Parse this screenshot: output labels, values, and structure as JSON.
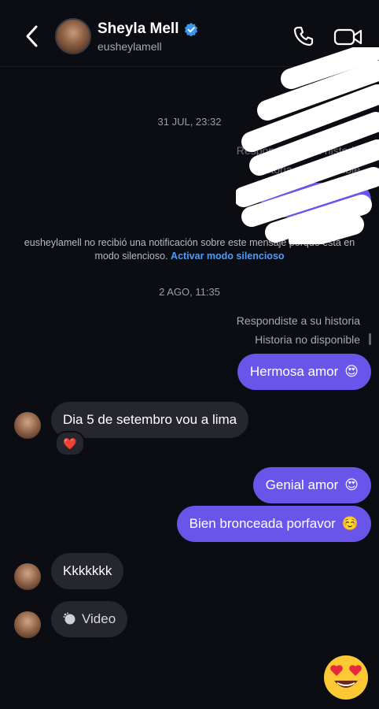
{
  "header": {
    "contact_name": "Sheyla Mell",
    "username": "eusheylamell"
  },
  "thread": {
    "timestamp_1": "31 JUL, 23:32",
    "faded_reply_note": "Respondiste a su historia",
    "faded_story_note": "Historia no disponible",
    "silent_notice_text": "eusheylamell no recibió una notificación sobre este mensaje porque está en modo silencioso.",
    "silent_notice_link": "Activar modo silencioso",
    "timestamp_2": "2 AGO, 11:35",
    "reply_note": "Respondiste a su historia",
    "story_note": "Historia no disponible",
    "messages": [
      {
        "text": "Hermosa amor",
        "emoji": "😍"
      },
      {
        "text": "Dia 5 de setembro vou a lima"
      },
      {
        "text": "Genial amor",
        "emoji": "😍"
      },
      {
        "text": "Bien bronceada porfavor",
        "emoji": "☺️"
      },
      {
        "text": "Kkkkkkk"
      },
      {
        "text": "Video"
      }
    ],
    "reaction": "❤️"
  },
  "colors": {
    "background": "#0c0d12",
    "outgoing_bubble": "#6a55ea",
    "incoming_bubble": "#25262e",
    "link": "#4f9cf5",
    "verified_badge": "#3897f0"
  },
  "icons": [
    "back-chevron-icon",
    "verified-badge-icon",
    "phone-icon",
    "video-call-icon",
    "video-play-icon",
    "heart-eyes-emoji-icon"
  ]
}
